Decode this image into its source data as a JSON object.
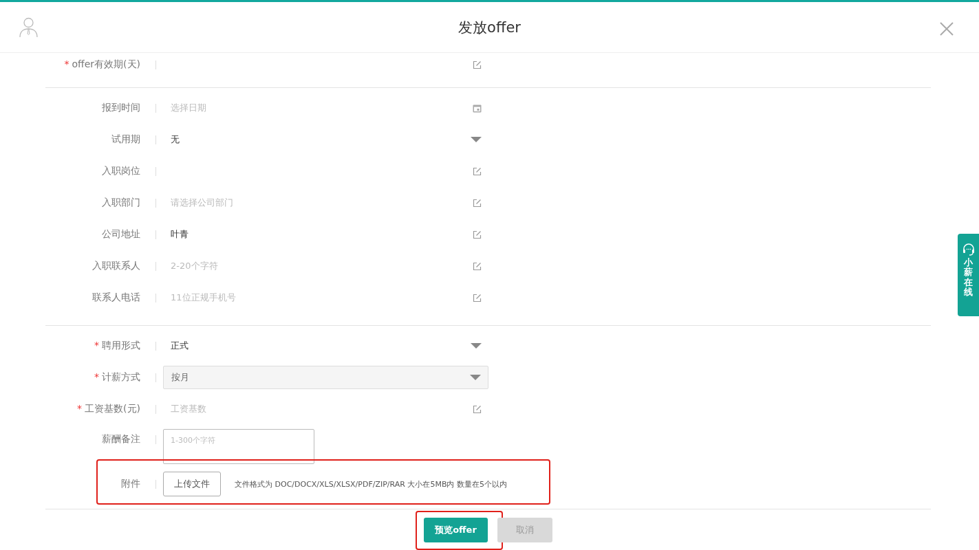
{
  "dialog": {
    "title": "发放offer"
  },
  "sections": [
    {
      "fields": [
        {
          "label": "offer有效期(天)",
          "required": true,
          "kind": "text"
        }
      ]
    },
    {
      "fields": [
        {
          "label": "报到时间",
          "required": false,
          "kind": "date",
          "placeholder": "选择日期"
        },
        {
          "label": "试用期",
          "required": false,
          "kind": "select",
          "value": "无"
        },
        {
          "label": "入职岗位",
          "required": false,
          "kind": "text"
        },
        {
          "label": "入职部门",
          "required": false,
          "kind": "text",
          "placeholder": "请选择公司部门"
        },
        {
          "label": "公司地址",
          "required": false,
          "kind": "text",
          "value": "叶青"
        },
        {
          "label": "入职联系人",
          "required": false,
          "kind": "text",
          "placeholder": "2-20个字符"
        },
        {
          "label": "联系人电话",
          "required": false,
          "kind": "text",
          "placeholder": "11位正规手机号"
        }
      ]
    },
    {
      "fields": [
        {
          "label": "聘用形式",
          "required": true,
          "kind": "select",
          "value": "正式"
        },
        {
          "label": "计薪方式",
          "required": true,
          "kind": "select",
          "disabled": true,
          "value": "按月"
        },
        {
          "label": "工资基数(元)",
          "required": true,
          "kind": "text",
          "placeholder": "工资基数"
        },
        {
          "label": "薪酬备注",
          "required": false,
          "kind": "textarea",
          "placeholder": "1-300个字符"
        },
        {
          "label": "附件",
          "required": false,
          "kind": "upload",
          "button": "上传文件",
          "hint": "文件格式为 DOC/DOCX/XLS/XLSX/PDF/ZIP/RAR 大小在5MB内 数量在5个以内",
          "highlighted": true
        }
      ]
    }
  ],
  "required_mark": "*",
  "footer": {
    "buttons": [
      {
        "label": "预览offer",
        "kind": "primary",
        "disabled": false,
        "highlighted": true
      },
      {
        "label": "取消",
        "kind": "secondary",
        "disabled": true,
        "highlighted": false
      }
    ]
  },
  "support_widget": {
    "label": "小薪在线"
  }
}
